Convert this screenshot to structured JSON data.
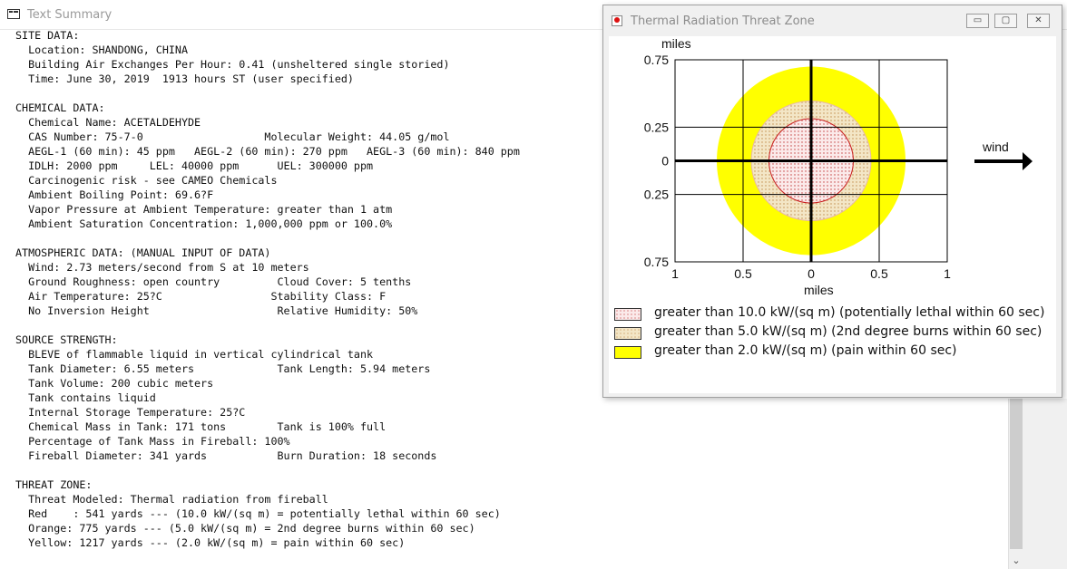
{
  "text_summary": {
    "title": "Text Summary",
    "lines": [
      "SITE DATA:",
      "  Location: SHANDONG, CHINA",
      "  Building Air Exchanges Per Hour: 0.41 (unsheltered single storied)",
      "  Time: June 30, 2019  1913 hours ST (user specified)",
      "",
      "CHEMICAL DATA:",
      "  Chemical Name: ACETALDEHYDE",
      "  CAS Number: 75-7-0                   Molecular Weight: 44.05 g/mol",
      "  AEGL-1 (60 min): 45 ppm   AEGL-2 (60 min): 270 ppm   AEGL-3 (60 min): 840 ppm",
      "  IDLH: 2000 ppm     LEL: 40000 ppm      UEL: 300000 ppm",
      "  Carcinogenic risk - see CAMEO Chemicals",
      "  Ambient Boiling Point: 69.6?F",
      "  Vapor Pressure at Ambient Temperature: greater than 1 atm",
      "  Ambient Saturation Concentration: 1,000,000 ppm or 100.0%",
      "",
      "ATMOSPHERIC DATA: (MANUAL INPUT OF DATA)",
      "  Wind: 2.73 meters/second from S at 10 meters",
      "  Ground Roughness: open country         Cloud Cover: 5 tenths",
      "  Air Temperature: 25?C                 Stability Class: F",
      "  No Inversion Height                    Relative Humidity: 50%",
      "",
      "SOURCE STRENGTH:",
      "  BLEVE of flammable liquid in vertical cylindrical tank",
      "  Tank Diameter: 6.55 meters             Tank Length: 5.94 meters",
      "  Tank Volume: 200 cubic meters",
      "  Tank contains liquid",
      "  Internal Storage Temperature: 25?C",
      "  Chemical Mass in Tank: 171 tons        Tank is 100% full",
      "  Percentage of Tank Mass in Fireball: 100%",
      "  Fireball Diameter: 341 yards           Burn Duration: 18 seconds",
      "",
      "THREAT ZONE:",
      "  Threat Modeled: Thermal radiation from fireball",
      "  Red    : 541 yards --- (10.0 kW/(sq m) = potentially lethal within 60 sec)",
      "  Orange: 775 yards --- (5.0 kW/(sq m) = 2nd degree burns within 60 sec)",
      "  Yellow: 1217 yards --- (2.0 kW/(sq m) = pain within 60 sec)"
    ]
  },
  "threat_window": {
    "title": "Thermal Radiation Threat Zone",
    "buttons": {
      "minimize": "▭",
      "maximize": "▢",
      "close": "✕"
    },
    "icons": {
      "app": "threat-zone-icon",
      "wind_arrow": "arrow-right-icon"
    },
    "y_axis_label": "miles",
    "x_axis_label": "miles",
    "wind_label": "wind",
    "y_tick_labels": [
      "0.75",
      "0.25",
      "0",
      "0.25",
      "0.75"
    ],
    "x_tick_labels": [
      "1",
      "0.5",
      "0",
      "0.5",
      "1"
    ],
    "legend": [
      {
        "label": "greater than 10.0 kW/(sq m) (potentially lethal within 60 sec)",
        "color": "#f5e0e0",
        "pattern": "red-dots"
      },
      {
        "label": "greater than 5.0 kW/(sq m) (2nd degree burns within 60 sec)",
        "color": "#f0e2c0",
        "pattern": "orange-dots"
      },
      {
        "label": "greater than 2.0 kW/(sq m) (pain within 60 sec)",
        "color": "#ffff00",
        "pattern": "solid"
      }
    ]
  },
  "chart_data": {
    "type": "threat-zone-circles",
    "x_unit": "miles",
    "y_unit": "miles",
    "xlim": [
      -1,
      1
    ],
    "ylim": [
      -0.75,
      0.75
    ],
    "grid": true,
    "zones": [
      {
        "name": "Yellow",
        "radius_miles": 0.69,
        "color": "#ffff00"
      },
      {
        "name": "Orange",
        "radius_miles": 0.44,
        "color": "#f0e2c0"
      },
      {
        "name": "Red",
        "radius_miles": 0.31,
        "color": "#f5e0e0"
      }
    ],
    "wind_direction": "east"
  }
}
